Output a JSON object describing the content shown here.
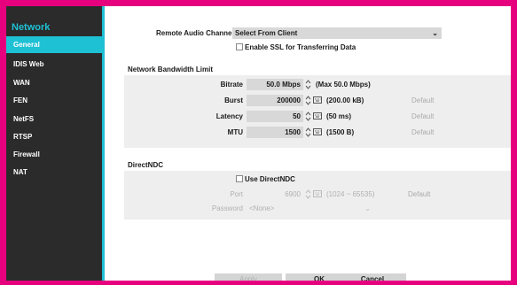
{
  "sidebar": {
    "title": "Network",
    "items": [
      {
        "label": "General"
      },
      {
        "label": "IDIS Web"
      },
      {
        "label": "WAN"
      },
      {
        "label": "FEN"
      },
      {
        "label": "NetFS"
      },
      {
        "label": "RTSP"
      },
      {
        "label": "Firewall"
      },
      {
        "label": "NAT"
      }
    ]
  },
  "general": {
    "audio_label": "Remote Audio Channel",
    "audio_value": "Select From Client",
    "ssl_label": "Enable SSL for Transferring Data",
    "ssl_checked": false
  },
  "bandwidth": {
    "section_title": "Network Bandwidth Limit",
    "bitrate": {
      "label": "Bitrate",
      "value": "50.0 Mbps",
      "note": "(Max 50.0 Mbps)"
    },
    "burst": {
      "label": "Burst",
      "value": "200000",
      "note": "(200.00 kB)",
      "default": "Default"
    },
    "latency": {
      "label": "Latency",
      "value": "50",
      "note": "(50 ms)",
      "default": "Default"
    },
    "mtu": {
      "label": "MTU",
      "value": "1500",
      "note": "(1500 B)",
      "default": "Default"
    }
  },
  "directndc": {
    "section_title": "DirectNDC",
    "use_label": "Use DirectNDC",
    "use_checked": false,
    "port_label": "Port",
    "port_value": "6900",
    "port_note": "(1024 ~ 65535)",
    "port_default": "Default",
    "password_label": "Password",
    "password_value": "<None>"
  },
  "buttons": {
    "apply": "Apply",
    "ok": "OK",
    "cancel": "Cancel"
  },
  "colors": {
    "accent": "#1ec0d4",
    "frame": "#e6007e",
    "sidebar": "#2b2b2b"
  }
}
